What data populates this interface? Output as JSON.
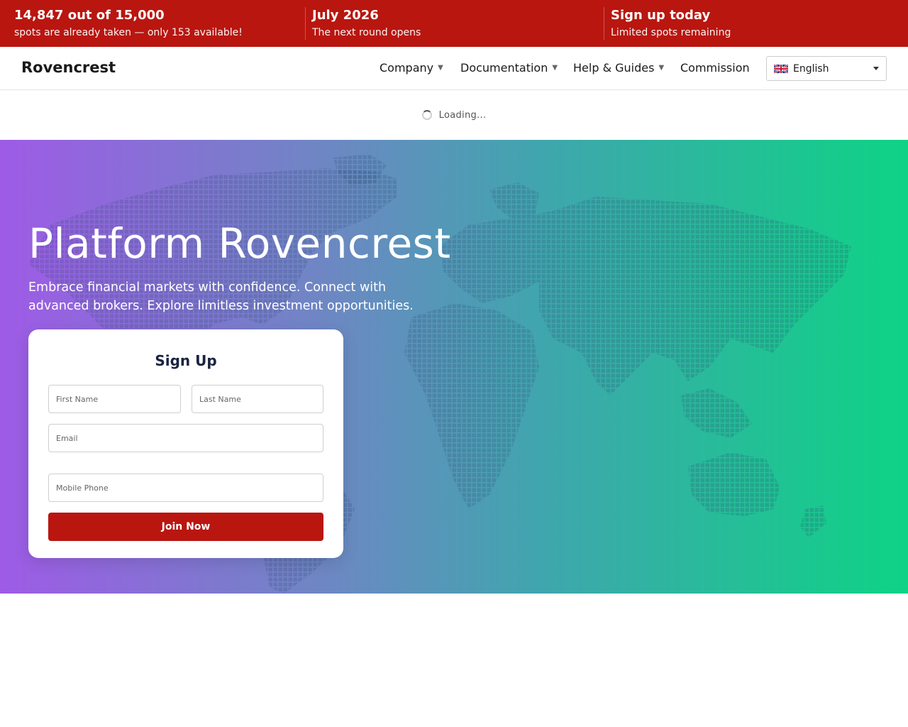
{
  "banner": {
    "items": [
      {
        "title": "14,847 out of 15,000",
        "subtitle": "spots are already taken — only 153 available!"
      },
      {
        "title": "July 2026",
        "subtitle": "The next round opens"
      },
      {
        "title": "Sign up today",
        "subtitle": "Limited spots remaining"
      }
    ]
  },
  "nav": {
    "logo": "Rovencrest",
    "items": [
      {
        "label": "Company",
        "has_dropdown": true
      },
      {
        "label": "Documentation",
        "has_dropdown": true
      },
      {
        "label": "Help & Guides",
        "has_dropdown": true
      },
      {
        "label": "Commission",
        "has_dropdown": false
      }
    ],
    "language": {
      "selected": "English",
      "flag_icon": "uk-flag-icon"
    }
  },
  "loading": {
    "text": "Loading..."
  },
  "hero": {
    "title": "Platform Rovencrest",
    "description": "Embrace financial markets with confidence. Connect with advanced brokers. Explore limitless investment opportunities.",
    "gradient_colors": [
      "#9e5be6",
      "#0ed385"
    ]
  },
  "signup": {
    "title": "Sign Up",
    "first_name_placeholder": "First Name",
    "last_name_placeholder": "Last Name",
    "email_placeholder": "Email",
    "phone_placeholder": "Mobile Phone",
    "submit_label": "Join Now"
  },
  "colors": {
    "accent": "#b91610",
    "card_title": "#1a2340"
  }
}
